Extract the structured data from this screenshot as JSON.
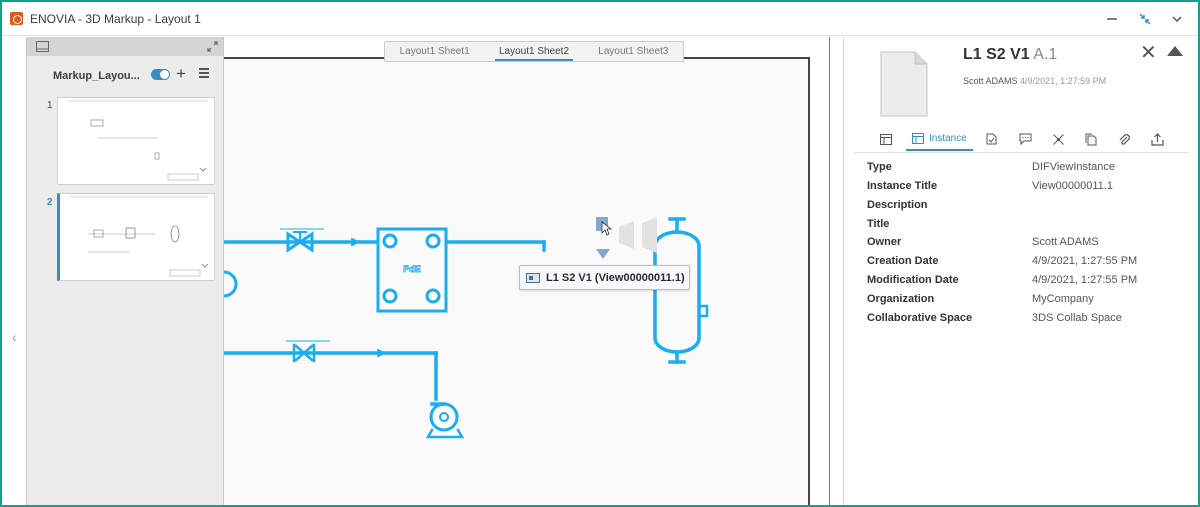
{
  "window": {
    "title": "ENOVIA - 3D Markup - Layout 1"
  },
  "thumbnails": {
    "title": "Markup_Layou...",
    "pages": [
      {
        "number": "1",
        "selected": false
      },
      {
        "number": "2",
        "selected": true
      }
    ]
  },
  "canvas": {
    "tabs": [
      {
        "label": "Layout1 Sheet1",
        "active": false
      },
      {
        "label": "Layout1 Sheet2",
        "active": true
      },
      {
        "label": "Layout1 Sheet3",
        "active": false
      }
    ],
    "tooltip": "L1 S2 V1 (View00000011.1)",
    "equipment_label": "PdE",
    "accent_color": "#1aaef0"
  },
  "properties": {
    "title": "L1 S2 V1",
    "revision": "A.1",
    "author": "Scott ADAMS",
    "timestamp": "4/9/2021, 1:27:59 PM",
    "active_tab": "Instance",
    "tab_icons": [
      "table-icon",
      "instance-icon",
      "document-icon",
      "comment-icon",
      "relations-icon",
      "files-icon",
      "attachment-icon",
      "share-icon"
    ],
    "rows": [
      {
        "key": "Type",
        "value": "DIFViewInstance"
      },
      {
        "key": "Instance Title",
        "value": "View00000011.1"
      },
      {
        "key": "Description",
        "value": ""
      },
      {
        "key": "Title",
        "value": ""
      },
      {
        "key": "Owner",
        "value": "Scott ADAMS"
      },
      {
        "key": "Creation Date",
        "value": "4/9/2021, 1:27:55 PM"
      },
      {
        "key": "Modification Date",
        "value": "4/9/2021, 1:27:55 PM"
      },
      {
        "key": "Organization",
        "value": "MyCompany"
      },
      {
        "key": "Collaborative Space",
        "value": "3DS Collab Space"
      }
    ]
  },
  "colors": {
    "frame": "#15a08a",
    "accent": "#368ec4",
    "diagram": "#1aaef0"
  }
}
